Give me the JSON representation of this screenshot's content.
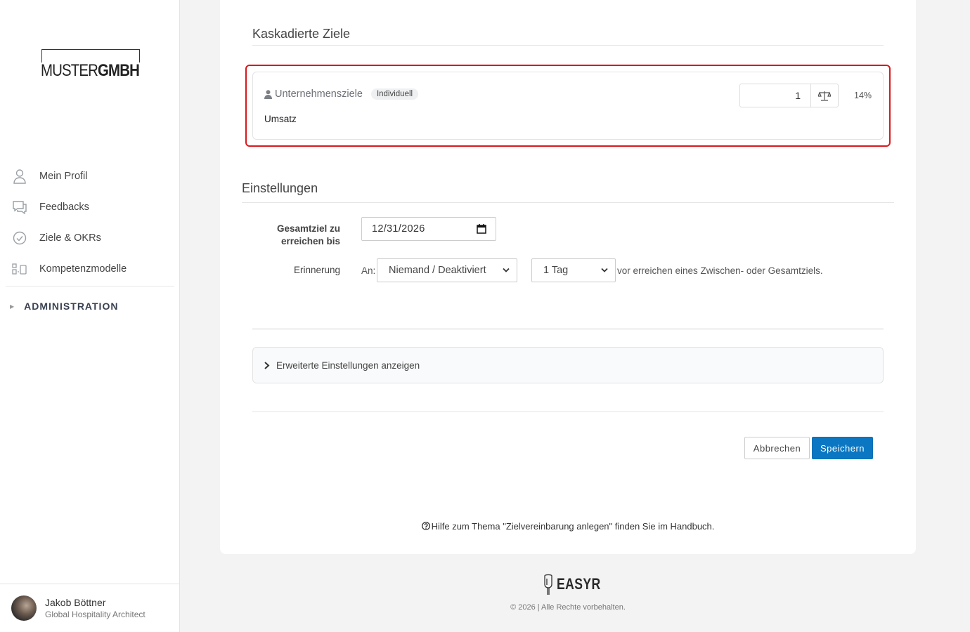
{
  "brand": {
    "logo_light": "MUSTER",
    "logo_bold": "GMBH"
  },
  "sidebar": {
    "items": [
      {
        "label": "Mein Profil",
        "icon": "user-icon"
      },
      {
        "label": "Feedbacks",
        "icon": "chat-icon"
      },
      {
        "label": "Ziele & OKRs",
        "icon": "check-circle-icon"
      },
      {
        "label": "Kompetenzmodelle",
        "icon": "modules-icon"
      }
    ],
    "admin_label": "ADMINISTRATION"
  },
  "user": {
    "name": "Jakob Böttner",
    "role": "Global Hospitality Architect"
  },
  "cascaded": {
    "title": "Kaskadierte Ziele",
    "goal": {
      "name": "Unternehmensziele",
      "badge": "Individuell",
      "subtitle": "Umsatz",
      "weight": "1",
      "percent": "14%"
    }
  },
  "settings": {
    "title": "Einstellungen",
    "deadline_label_1": "Gesamtziel zu",
    "deadline_label_2": "erreichen bis",
    "deadline_value": "12/31/2026",
    "reminder_label": "Erinnerung",
    "recipient_prefix": "An:",
    "recipient_value": "Niemand / Deaktiviert",
    "interval_value": "1 Tag",
    "reminder_suffix": "vor erreichen eines Zwischen- oder Gesamtziels."
  },
  "advanced": {
    "label": "Erweiterte Einstellungen anzeigen"
  },
  "actions": {
    "cancel": "Abbrechen",
    "save": "Speichern"
  },
  "help": {
    "text": "Hilfe zum Thema \"Zielvereinbarung anlegen\" finden Sie im Handbuch."
  },
  "footer": {
    "brand": "EASYR",
    "copyright": "© 2026 | Alle Rechte vorbehalten."
  },
  "colors": {
    "primary": "#0b77c2",
    "highlight": "#d9191e"
  }
}
